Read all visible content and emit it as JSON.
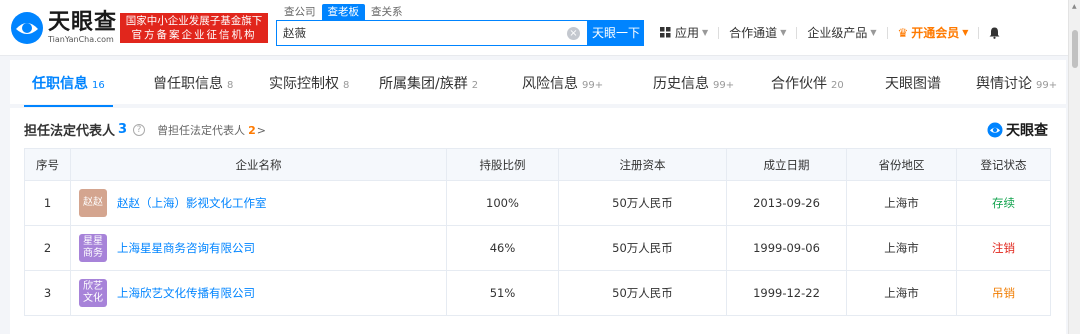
{
  "header": {
    "logo_cn": "天眼查",
    "logo_en": "TianYanCha.com",
    "badge_line1": "国家中小企业发展子基金旗下",
    "badge_line2": "官方备案企业征信机构",
    "search_tabs": [
      "查公司",
      "查老板",
      "查关系"
    ],
    "search_value": "赵薇",
    "search_button": "天眼一下",
    "nav": {
      "apps": "应用",
      "partner": "合作通道",
      "enterprise": "企业级产品",
      "vip": "开通会员"
    }
  },
  "tabs": [
    {
      "label": "任职信息",
      "count": "16"
    },
    {
      "label": "曾任职信息",
      "count": "8"
    },
    {
      "label": "实际控制权",
      "count": "8"
    },
    {
      "label": "所属集团/族群",
      "count": "2"
    },
    {
      "label": "风险信息",
      "count": "99+"
    },
    {
      "label": "历史信息",
      "count": "99+"
    },
    {
      "label": "合作伙伴",
      "count": "20"
    },
    {
      "label": "天眼图谱",
      "count": ""
    },
    {
      "label": "舆情讨论",
      "count": "99+"
    }
  ],
  "section": {
    "title": "担任法定代表人",
    "count": "3",
    "former_label": "曾担任法定代表人",
    "former_count": "2",
    "brand": "天眼查"
  },
  "table": {
    "headers": [
      "序号",
      "企业名称",
      "持股比例",
      "注册资本",
      "成立日期",
      "省份地区",
      "登记状态"
    ],
    "rows": [
      {
        "idx": "1",
        "avatar": "赵赵",
        "avatar_color": "#d4a58f",
        "name": "赵赵（上海）影视文化工作室",
        "share": "100%",
        "capital": "50万人民币",
        "date": "2013-09-26",
        "region": "上海市",
        "status": "存续",
        "status_color": "#11a34d"
      },
      {
        "idx": "2",
        "avatar": "星星商务",
        "avatar_color": "#a783d9",
        "name": "上海星星商务咨询有限公司",
        "share": "46%",
        "capital": "50万人民币",
        "date": "1999-09-06",
        "region": "上海市",
        "status": "注销",
        "status_color": "#e1261c"
      },
      {
        "idx": "3",
        "avatar": "欣艺文化",
        "avatar_color": "#a783d9",
        "name": "上海欣艺文化传播有限公司",
        "share": "51%",
        "capital": "50万人民币",
        "date": "1999-12-22",
        "region": "上海市",
        "status": "吊销",
        "status_color": "#f07c00"
      }
    ]
  }
}
